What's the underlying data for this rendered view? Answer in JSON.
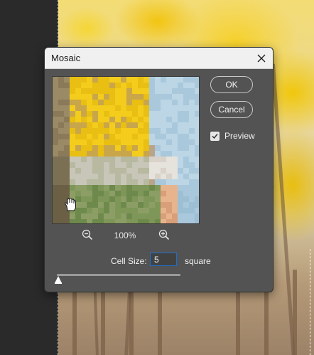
{
  "dialog": {
    "title": "Mosaic",
    "ok_label": "OK",
    "cancel_label": "Cancel",
    "preview_label": "Preview",
    "preview_checked": true,
    "zoom_level": "100%",
    "cell_size_label": "Cell Size:",
    "cell_size_value": "5",
    "cell_size_unit": "square",
    "slider_fraction": 0.0
  },
  "icons": {
    "close": "close-icon",
    "zoom_out": "zoom-out-icon",
    "zoom_in": "zoom-in-icon",
    "hand": "hand-tool-icon",
    "checkmark": "checkmark-icon"
  },
  "colors": {
    "dialog_bg": "#535353",
    "title_bg": "#f0f0f0",
    "input_focus": "#1e6fd0",
    "foliage_yellow": "#f2c511"
  }
}
